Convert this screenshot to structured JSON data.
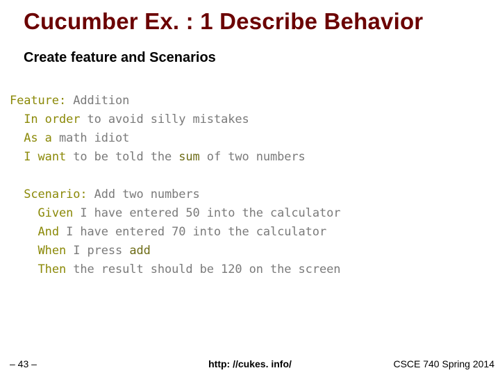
{
  "title": "Cucumber Ex. : 1 Describe Behavior",
  "subtitle": "Create feature and Scenarios",
  "code": {
    "l1": {
      "kw": "Feature:",
      "rest": " Addition"
    },
    "l2": {
      "kw": "In order",
      "rest": " to avoid silly mistakes"
    },
    "l3": {
      "kw": "As a",
      "rest": " math idiot"
    },
    "l4": {
      "kw_a": "I want",
      "mid": " to be told the ",
      "accent": "sum",
      "rest": " of two numbers"
    },
    "l5": "",
    "l6": {
      "kw": "Scenario:",
      "rest": " Add two numbers"
    },
    "l7": {
      "kw": "Given",
      "rest": " I have entered 50 into the calculator"
    },
    "l8": {
      "kw": "And",
      "rest": " I have entered 70 into the calculator"
    },
    "l9": {
      "kw": "When",
      "mid": " I press ",
      "accent": "add"
    },
    "l10": {
      "kw": "Then",
      "rest": " the result should be 120 on the screen"
    }
  },
  "footer": {
    "page": "– 43 –",
    "link": "http: //cukes. info/",
    "course": "CSCE 740 Spring 2014"
  }
}
